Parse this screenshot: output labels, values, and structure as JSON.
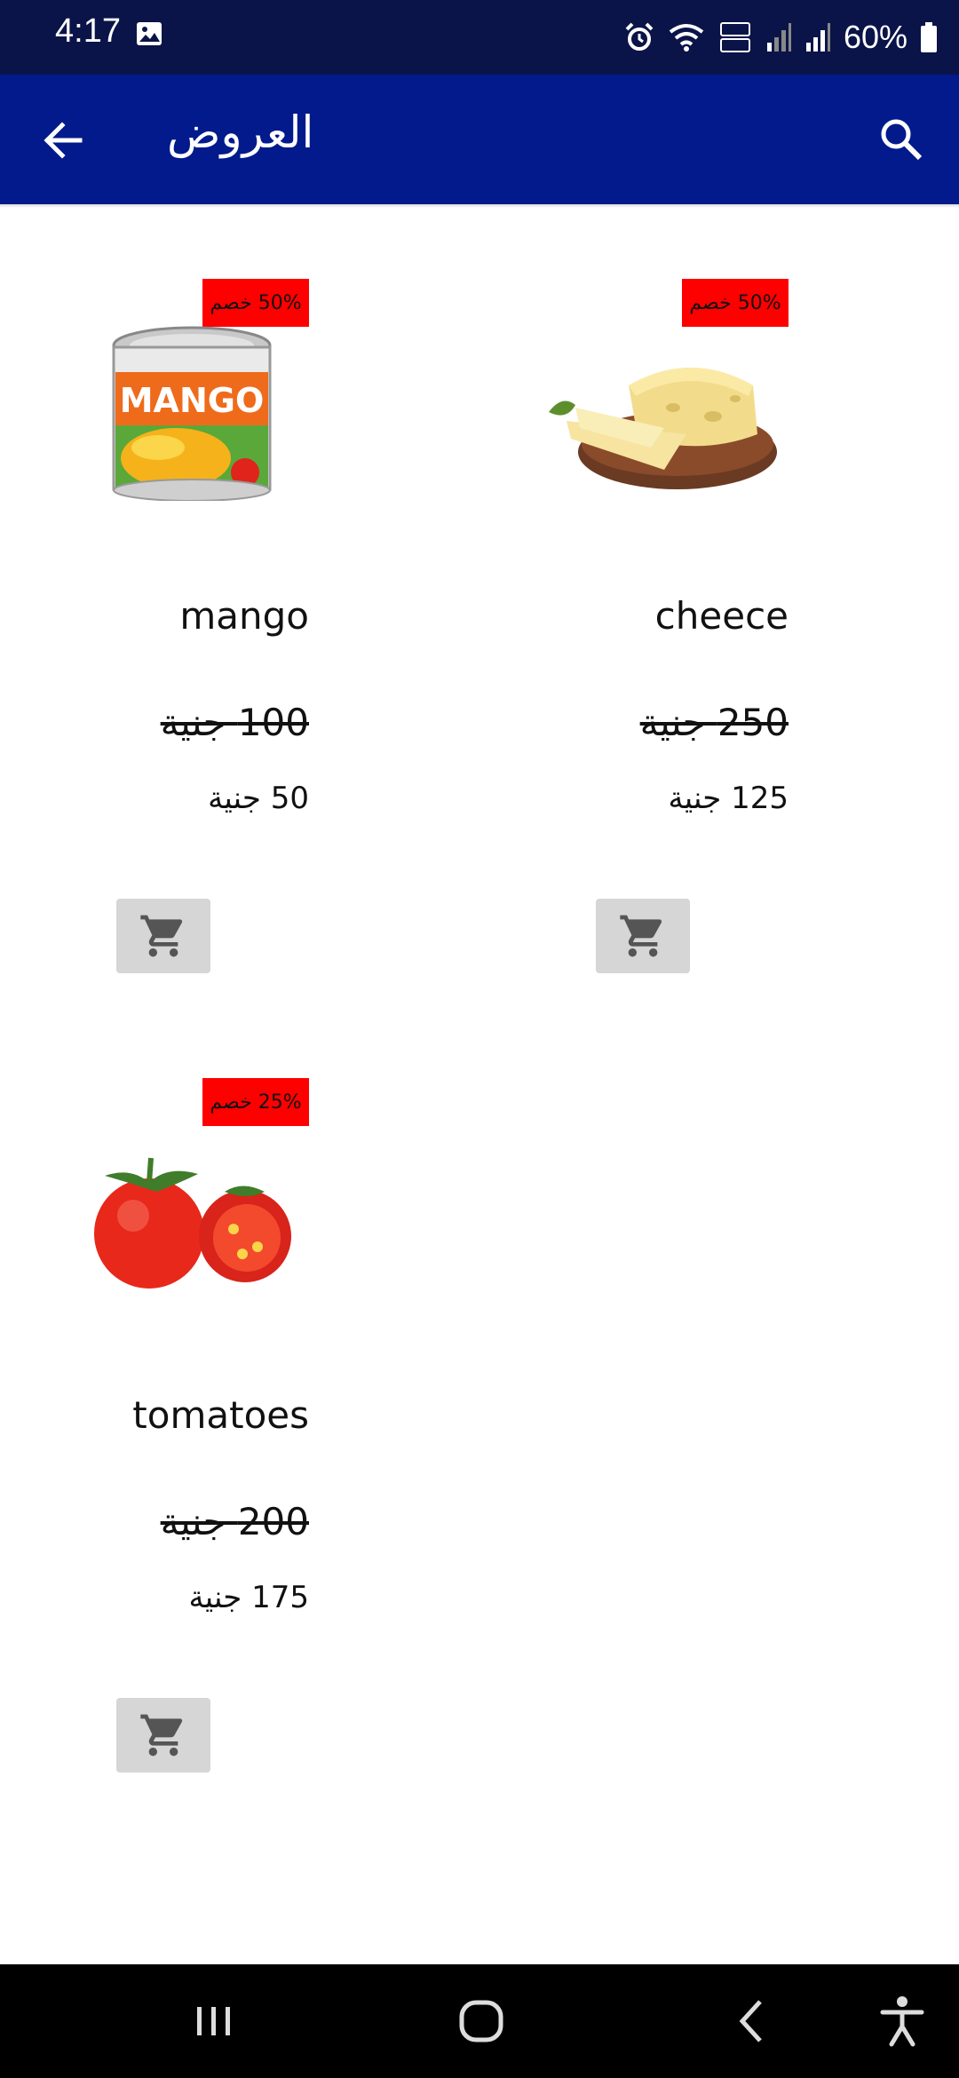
{
  "status_bar": {
    "time": "4:17",
    "battery": "60%"
  },
  "app_bar": {
    "title": "العروض"
  },
  "products": [
    {
      "name": "mango",
      "badge": "50% خصم",
      "old_price": "100 جنية",
      "new_price": "50 جنية",
      "image_icon": "mango-can-image"
    },
    {
      "name": "cheece",
      "badge": "50% خصم",
      "old_price": "250 جنية",
      "new_price": "125 جنية",
      "image_icon": "cheese-image"
    },
    {
      "name": "tomatoes",
      "badge": "25% خصم",
      "old_price": "200 جنية",
      "new_price": "175 جنية",
      "image_icon": "tomatoes-image"
    }
  ],
  "colors": {
    "status_bar": "#0a1448",
    "app_bar": "#021a8c",
    "badge": "#ff0000",
    "cart_button": "#d6d6d6",
    "nav_bar": "#000000"
  }
}
